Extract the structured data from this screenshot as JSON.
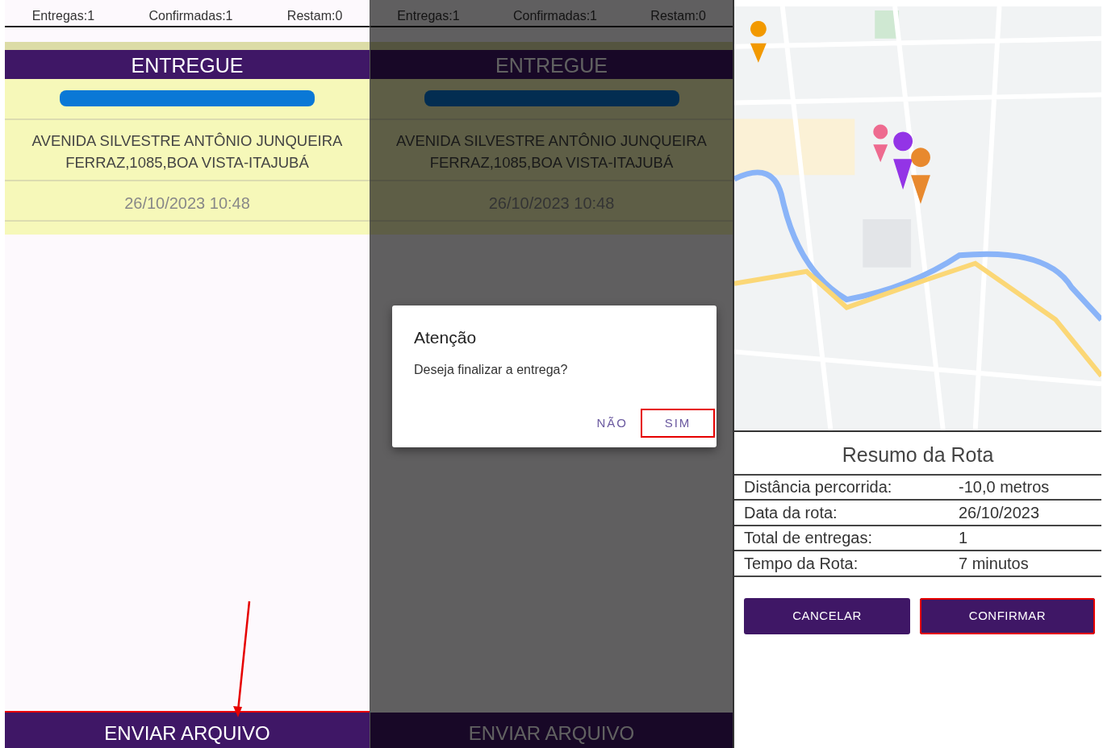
{
  "panels": [
    {
      "kind": "delivery",
      "counters": [
        "Entregas:1",
        "Confirmadas:1",
        "Restam:0"
      ],
      "status": "ENTREGUE",
      "redacted": true,
      "address": "AVENIDA SILVESTRE ANTÔNIO JUNQUEIRA FERRAZ,1085,BOA VISTA-ITAJUBÁ",
      "datetime": "26/10/2023 10:48",
      "footer_button": {
        "label": "ENVIAR ARQUIVO",
        "highlighted": true
      },
      "pointer_arrow": true
    },
    {
      "kind": "delivery",
      "dimmed": true,
      "counters": [
        "Entregas:1",
        "Confirmadas:1",
        "Restam:0"
      ],
      "status": "ENTREGUE",
      "redacted": true,
      "address": "AVENIDA SILVESTRE ANTÔNIO JUNQUEIRA FERRAZ,1085,BOA VISTA-ITAJUBÁ",
      "datetime": "26/10/2023 10:48",
      "footer_button": {
        "label": "ENVIAR ARQUIVO",
        "highlighted": false
      },
      "dialog": {
        "title": "Atenção",
        "message": "Deseja finalizar a entrega?",
        "buttons": [
          {
            "label": "NÃO",
            "highlighted": false
          },
          {
            "label": "SIM",
            "highlighted": true
          }
        ]
      }
    },
    {
      "kind": "route_summary",
      "map": {
        "kind": "picture"
      },
      "title": "Resumo da Rota",
      "rows": [
        {
          "label": "Distância percorrida:",
          "value": "-10,0 metros"
        },
        {
          "label": "Data da rota:",
          "value": "26/10/2023"
        },
        {
          "label": "Total de entregas:",
          "value": "1"
        },
        {
          "label": "Tempo da Rota:",
          "value": "7 minutos"
        }
      ],
      "buttons": [
        {
          "label": "CANCELAR",
          "highlighted": false
        },
        {
          "label": "CONFIRMAR",
          "highlighted": true
        }
      ]
    }
  ]
}
